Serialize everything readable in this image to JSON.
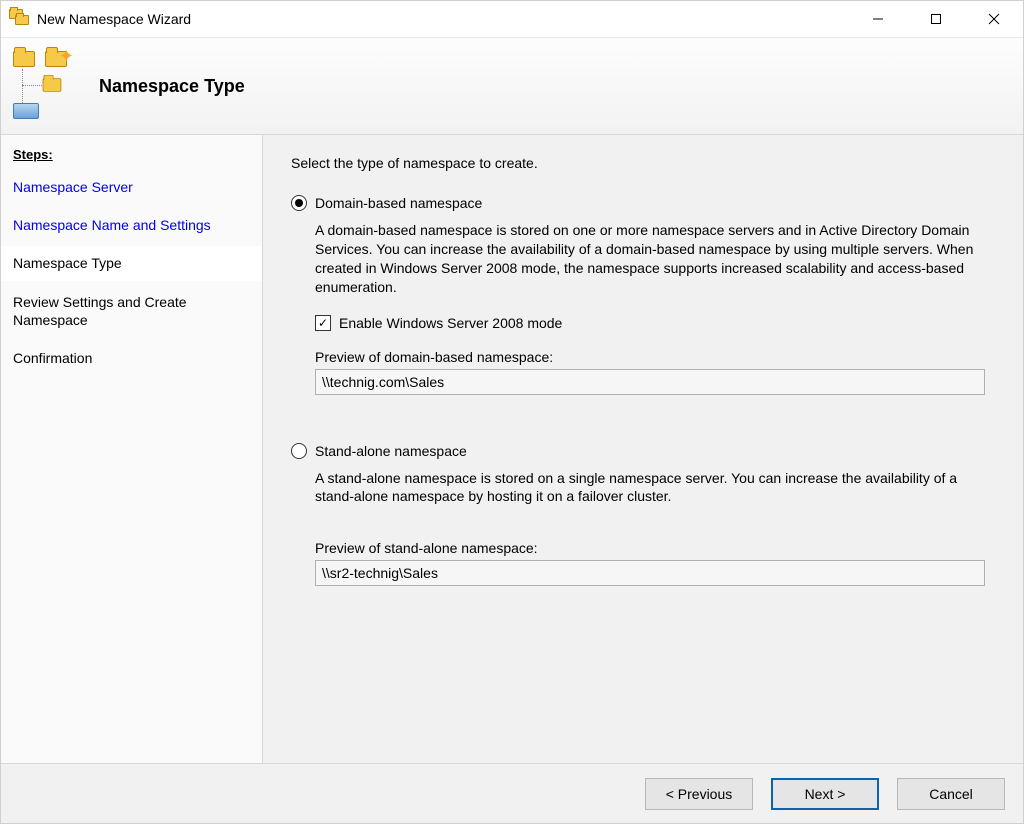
{
  "window": {
    "title": "New Namespace Wizard"
  },
  "banner": {
    "title": "Namespace Type"
  },
  "sidebar": {
    "header": "Steps:",
    "steps": [
      {
        "label": "Namespace Server",
        "state": "past"
      },
      {
        "label": "Namespace Name and Settings",
        "state": "past"
      },
      {
        "label": "Namespace Type",
        "state": "current"
      },
      {
        "label": "Review Settings and Create Namespace",
        "state": "future"
      },
      {
        "label": "Confirmation",
        "state": "future"
      }
    ]
  },
  "main": {
    "intro": "Select the type of namespace to create.",
    "domain_option": {
      "label": "Domain-based namespace",
      "selected": true,
      "description": "A domain-based namespace is stored on one or more namespace servers and in Active Directory Domain Services. You can increase the availability of a domain-based namespace by using multiple servers. When created in Windows Server 2008 mode, the namespace supports increased scalability and access-based enumeration.",
      "checkbox_label": "Enable Windows Server 2008 mode",
      "checkbox_checked": true,
      "preview_label": "Preview of domain-based namespace:",
      "preview_value": "\\\\technig.com\\Sales"
    },
    "standalone_option": {
      "label": "Stand-alone namespace",
      "selected": false,
      "description": "A stand-alone namespace is stored on a single namespace server. You can increase the availability of a stand-alone namespace by hosting it on a failover cluster.",
      "preview_label": "Preview of stand-alone namespace:",
      "preview_value": "\\\\sr2-technig\\Sales"
    }
  },
  "footer": {
    "previous": "< Previous",
    "next": "Next >",
    "cancel": "Cancel"
  }
}
